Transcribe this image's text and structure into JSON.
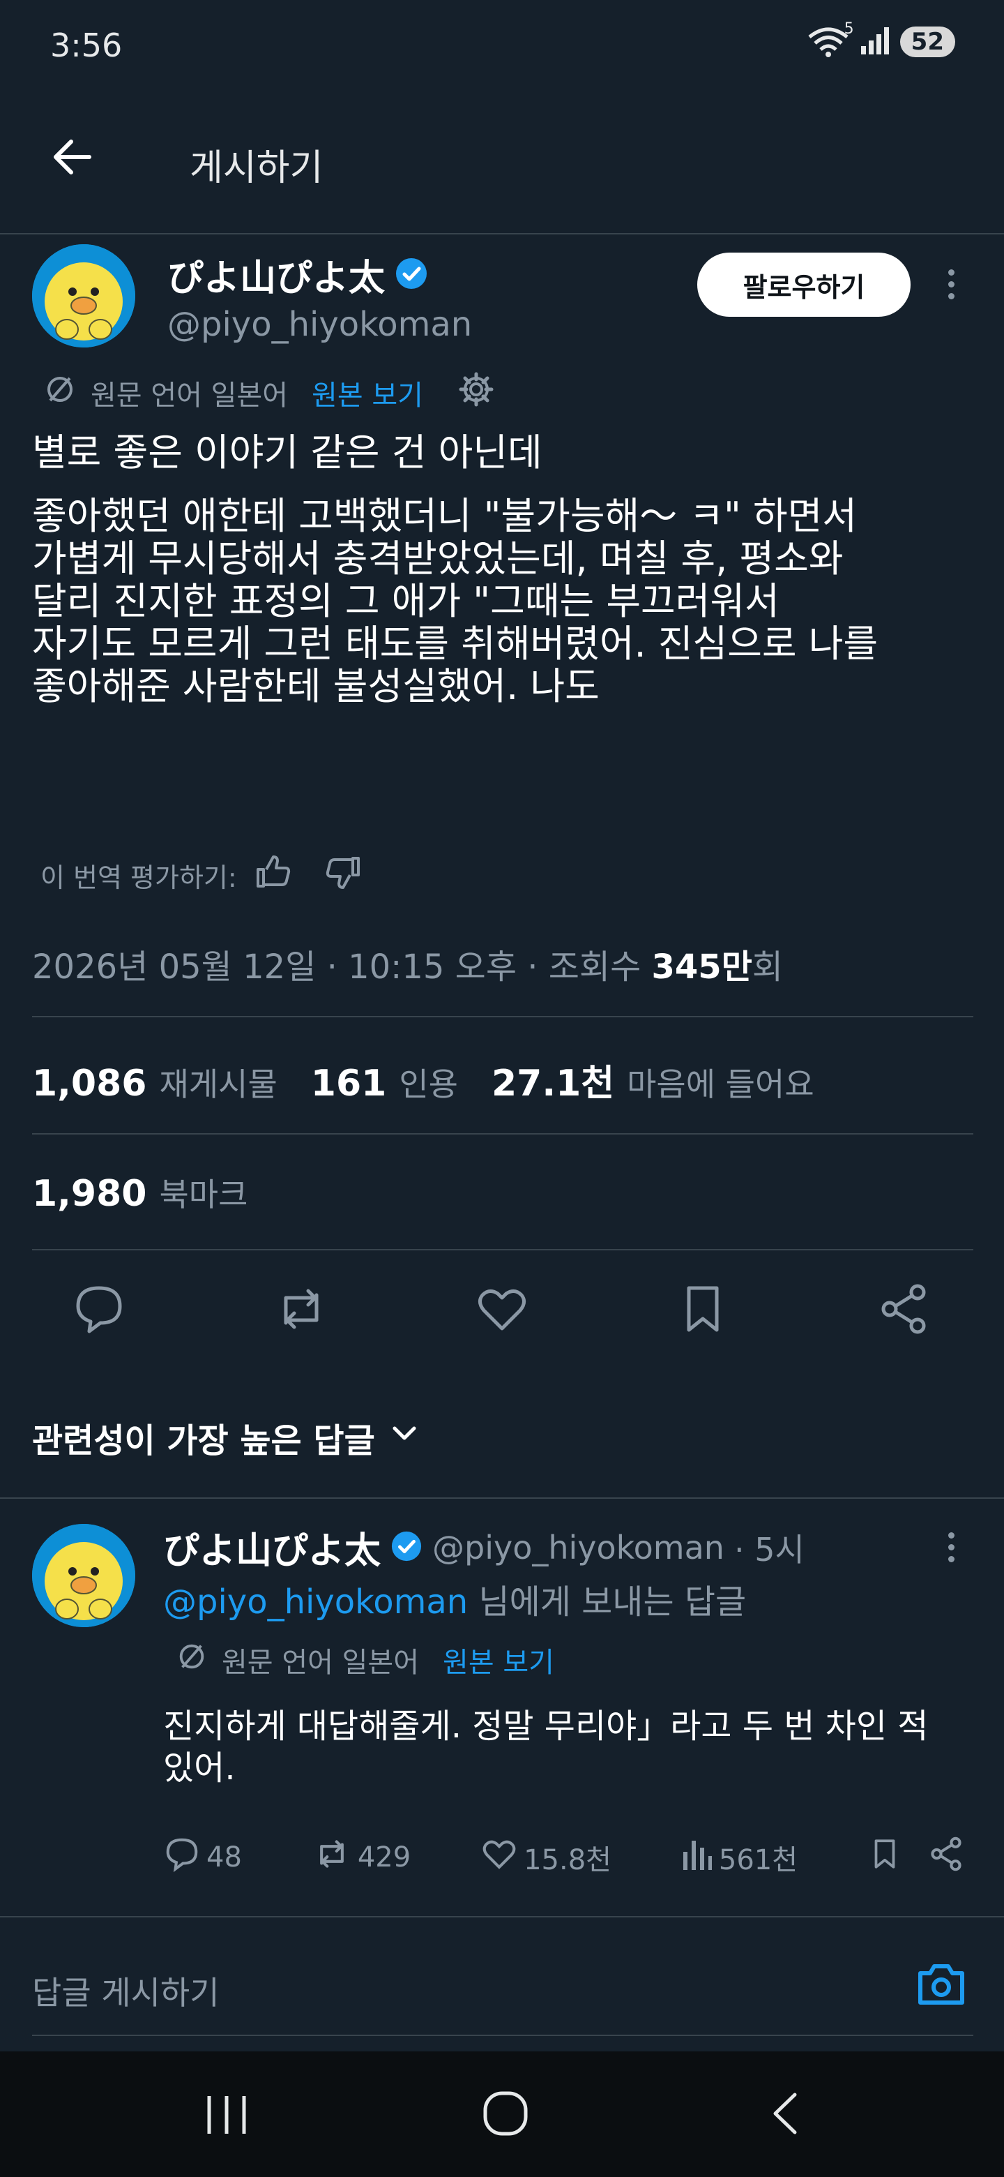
{
  "status": {
    "time": "3:56",
    "battery": "52",
    "wifi_badge": "5"
  },
  "header": {
    "title": "게시하기"
  },
  "post": {
    "author_name": "ぴよ山ぴよ太",
    "author_handle": "@piyo_hiyokoman",
    "follow_label": "팔로우하기",
    "translation_note": "원문 언어 일본어",
    "show_original": "원본 보기",
    "lines": [
      "별로 좋은 이야기 같은 건 아닌데",
      "좋아했던 애한테 고백했더니 \"불가능해～ ㅋ\" 하면서",
      "가볍게 무시당해서 충격받았었는데, 며칠 후, 평소와",
      "달리 진지한 표정의 그 애가 \"그때는 부끄러워서",
      "자기도 모르게 그런 태도를 취해버렸어. 진심으로 나를",
      "좋아해준 사람한테 불성실했어. 나도"
    ],
    "rate_label": "이 번역 평가하기:",
    "timestamp": "2026년 05월 12일 · 10:15 오후 · 조회수 ",
    "views_value": "345만",
    "views_suffix": "회",
    "reposts_value": "1,086",
    "reposts_label": "재게시물",
    "quotes_value": "161",
    "quotes_label": "인용",
    "likes_value": "27.1천",
    "likes_label": "마음에 들어요",
    "bookmarks_value": "1,980",
    "bookmarks_label": "북마크"
  },
  "replies_header": "관련성이 가장 높은 답글",
  "reply": {
    "author_name": "ぴよ山ぴよ太",
    "author_handle": "@piyo_hiyokoman",
    "time": " · 5시",
    "reply_to_handle": "@piyo_hiyokoman",
    "reply_to_suffix": " 님에게 보내는 답글",
    "translation_note": "원문 언어 일본어",
    "show_original": "원본 보기",
    "lines": [
      "진지하게 대답해줄게. 정말 무리야」라고 두 번 차인 적",
      "있어."
    ],
    "replies": "48",
    "reposts": "429",
    "likes": "15.8천",
    "views": "561천"
  },
  "compose_placeholder": "답글 게시하기",
  "colors": {
    "background": "#15202b",
    "accent": "#1d9bf0",
    "muted": "#8b98a5",
    "verified": "#1d9bf0"
  }
}
